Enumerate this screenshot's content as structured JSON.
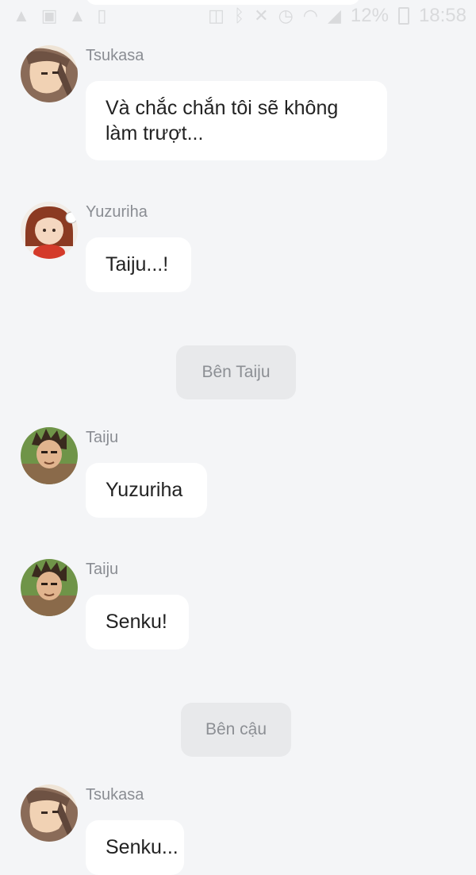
{
  "status_bar": {
    "battery": "12%",
    "time": "18:58",
    "icons_left": [
      "warning-icon",
      "image-icon",
      "warning-icon",
      "phone-icon"
    ],
    "icons_right": [
      "cast-icon",
      "bluetooth-icon",
      "mute-icon",
      "alarm-icon",
      "wifi-icon",
      "signal-icon",
      "battery-icon"
    ]
  },
  "messages": [
    {
      "sender": "Tsukasa",
      "text_line1": "Và chắc chắn tôi sẽ không",
      "text_line2": "làm trượt..."
    },
    {
      "sender": "Yuzuriha",
      "text": "Taiju...!"
    },
    {
      "divider": "Bên Taiju"
    },
    {
      "sender": "Taiju",
      "text": "Yuzuriha"
    },
    {
      "sender": "Taiju",
      "text": "Senku!"
    },
    {
      "divider": "Bên cậu"
    },
    {
      "sender": "Tsukasa",
      "text": "Senku..."
    }
  ]
}
